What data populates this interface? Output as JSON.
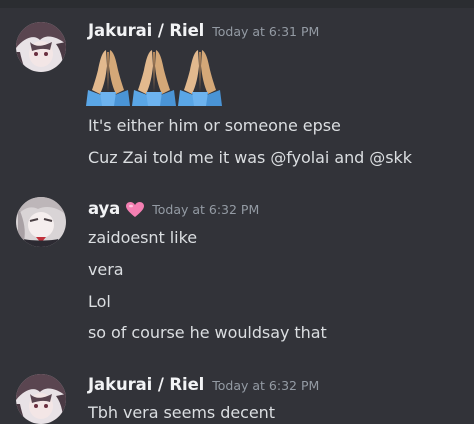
{
  "messages": [
    {
      "author": "Jakurai / Riel",
      "timestamp": "Today at 6:31 PM",
      "emojis": [
        "folded-hands",
        "folded-hands",
        "folded-hands"
      ],
      "lines": [
        "It's either him or someone epse",
        "Cuz Zai told me it was @fyolai and @skk"
      ]
    },
    {
      "author": "aya",
      "author_badge": "pink-heart",
      "timestamp": "Today at 6:32 PM",
      "lines": [
        "zaidoesnt like",
        "vera",
        "Lol",
        "so of course he wouldsay that"
      ]
    },
    {
      "author": "Jakurai / Riel",
      "timestamp": "Today at 6:32 PM",
      "lines": [
        "Tbh vera seems decent"
      ]
    }
  ],
  "colors": {
    "background": "#323339",
    "username": "#f2f3f5",
    "text": "#dbdee1",
    "timestamp": "#949ba4",
    "heart": "#f47fb2"
  }
}
